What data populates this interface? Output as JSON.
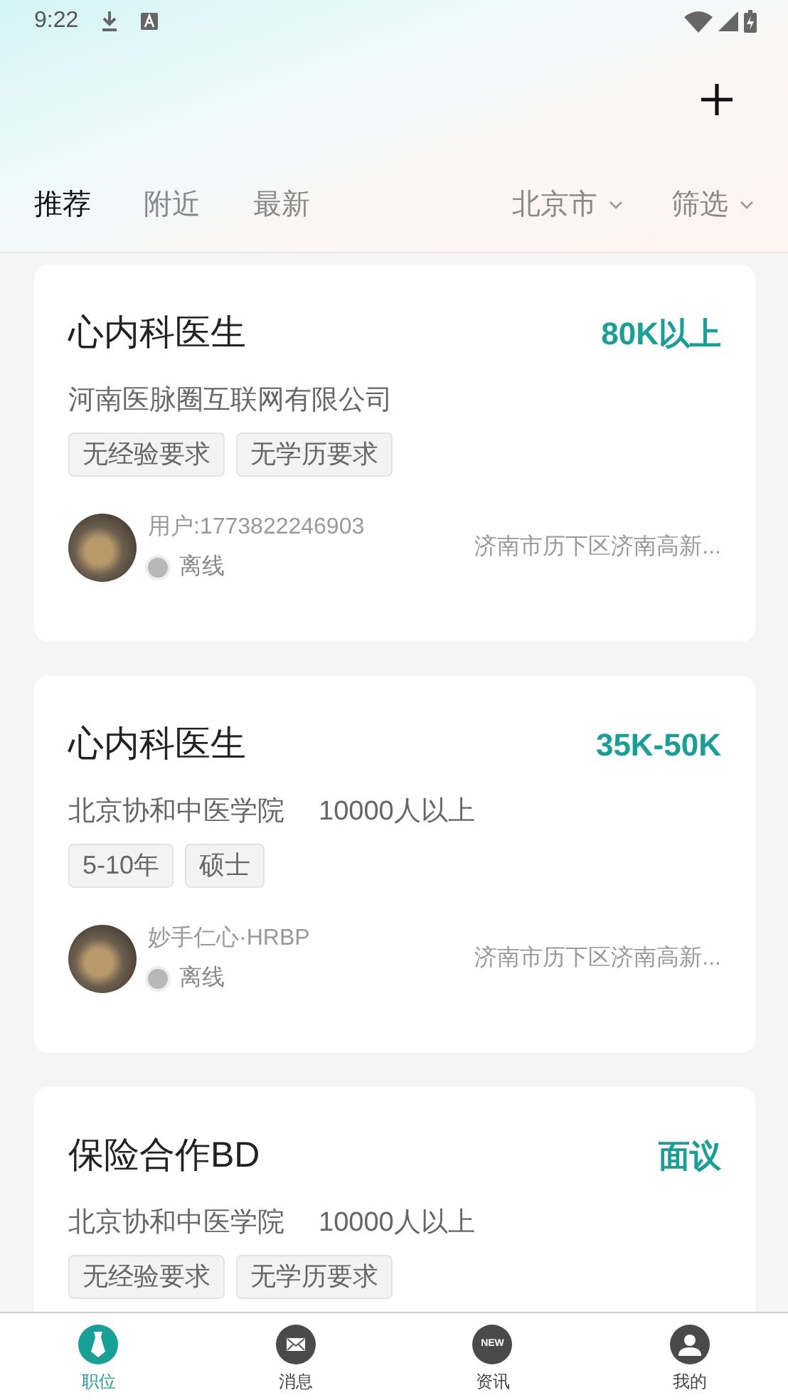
{
  "status_bar": {
    "time": "9:22"
  },
  "tabs": [
    {
      "label": "推荐",
      "selected": true
    },
    {
      "label": "附近",
      "selected": false
    },
    {
      "label": "最新",
      "selected": false
    }
  ],
  "filters": [
    {
      "label": "北京市"
    },
    {
      "label": "筛选"
    }
  ],
  "jobs": [
    {
      "title": "心内科医生",
      "salary": "80K以上",
      "company": "河南医脉圈互联网有限公司",
      "tags": [
        "无经验要求",
        "无学历要求"
      ],
      "recruiter": {
        "name": "用户:1773822246903",
        "status": "离线",
        "online": false
      },
      "address": "济南市历下区济南高新..."
    },
    {
      "title": "心内科医生",
      "salary": "35K-50K",
      "company": "北京协和中医学院",
      "company_size": "10000人以上",
      "tags": [
        "5-10年",
        "硕士"
      ],
      "recruiter": {
        "name": "妙手仁心·HRBP",
        "status": "离线",
        "online": false
      },
      "address": "济南市历下区济南高新..."
    },
    {
      "title": "保险合作BD",
      "salary": "面议",
      "company": "北京协和中医学院",
      "company_size": "10000人以上",
      "tags": [
        "无经验要求",
        "无学历要求"
      ]
    }
  ],
  "bottom_nav": [
    {
      "label": "职位",
      "selected": true,
      "kind": "tie"
    },
    {
      "label": "消息",
      "selected": false,
      "kind": "mail"
    },
    {
      "label": "资讯",
      "selected": false,
      "kind": "new",
      "icon_text": "NEW"
    },
    {
      "label": "我的",
      "selected": false,
      "kind": "person"
    }
  ]
}
